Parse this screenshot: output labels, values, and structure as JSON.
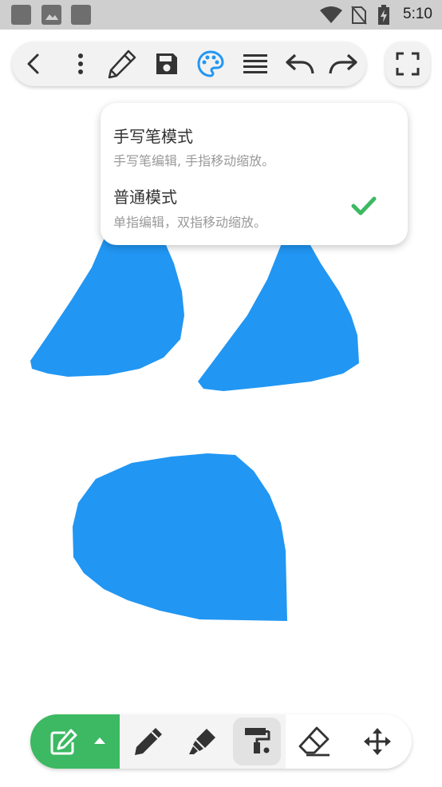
{
  "status_bar": {
    "time": "5:10",
    "icons": [
      "app-square-icon",
      "image-icon",
      "app-square-icon",
      "wifi-icon",
      "no-sim-icon",
      "battery-charging-icon"
    ]
  },
  "top_toolbar": {
    "buttons": [
      "back-icon",
      "more-vertical-icon",
      "pencil-icon",
      "save-icon",
      "palette-icon",
      "menu-lines-icon",
      "undo-icon",
      "redo-icon"
    ],
    "active_button": "palette-icon",
    "accent_color": "#2196f3",
    "fullscreen_button": "fullscreen-icon"
  },
  "mode_menu": {
    "items": [
      {
        "title": "手写笔模式",
        "subtitle": "手写笔编辑, 手指移动缩放。",
        "selected": false
      },
      {
        "title": "普通模式",
        "subtitle": "单指编辑，双指移动缩放。",
        "selected": true
      }
    ],
    "check_color": "#3cb962"
  },
  "canvas": {
    "fill_color": "#2196f3"
  },
  "bottom_toolbar": {
    "tools": [
      "edit-mode-icon",
      "arrow-up-icon",
      "pen-icon",
      "marker-icon",
      "paint-roller-icon",
      "eraser-icon",
      "move-icon"
    ],
    "selected_tool": "paint-roller-icon",
    "mode_color": "#3cb962"
  }
}
